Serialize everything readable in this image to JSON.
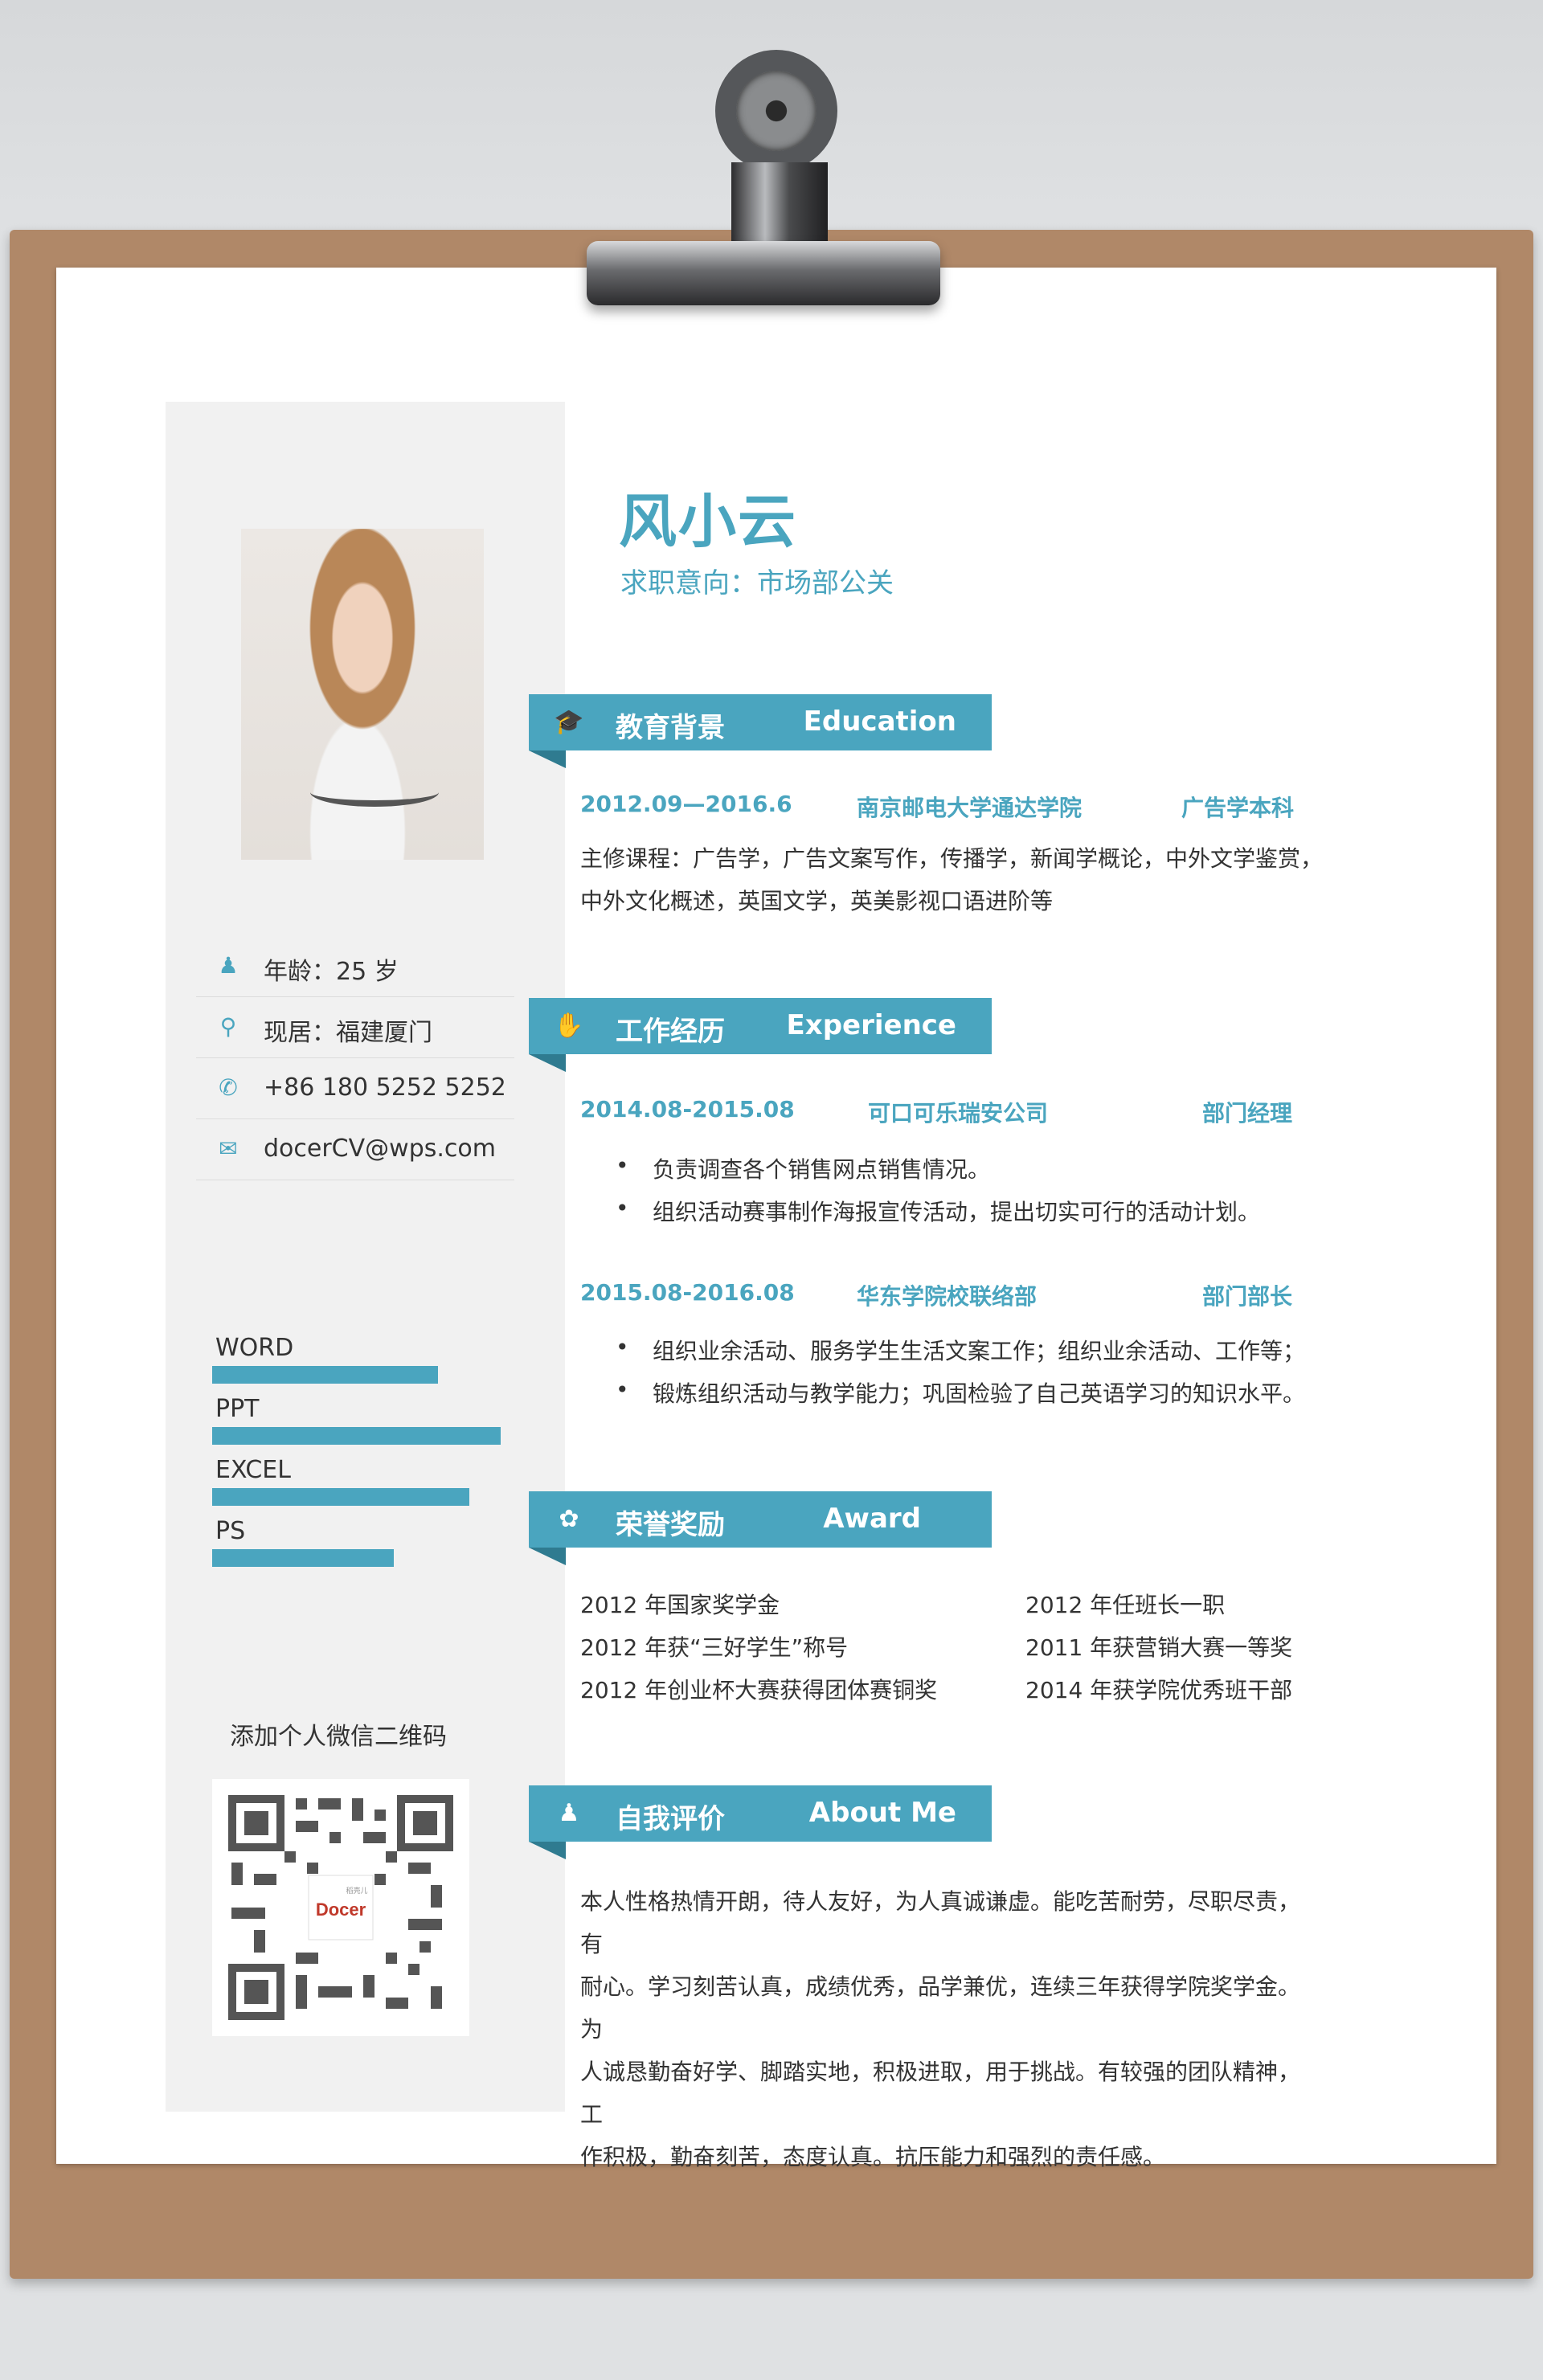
{
  "colors": {
    "accent": "#4aa5bf",
    "board": "#b08868",
    "sidebar": "#f1f1f1"
  },
  "resume": {
    "name": "风小云",
    "intent": "求职意向：市场部公关"
  },
  "personal": [
    {
      "icon": "person-icon",
      "text": "年龄：25 岁"
    },
    {
      "icon": "location-pin-icon",
      "text": "现居：福建厦门"
    },
    {
      "icon": "phone-icon",
      "text": "+86 180 5252 5252"
    },
    {
      "icon": "email-icon",
      "text": "docerCV@wps.com"
    }
  ],
  "skills": [
    {
      "name": "WORD",
      "level": 0.72
    },
    {
      "name": "PPT",
      "level": 0.92
    },
    {
      "name": "EXCEL",
      "level": 0.82
    },
    {
      "name": "PS",
      "level": 0.58
    }
  ],
  "qr": {
    "label": "添加个人微信二维码",
    "logo_text": "Docer",
    "logo_small": "稻壳儿"
  },
  "education": {
    "title_cn": "教育背景",
    "title_en": "Education",
    "icon": "graduation-cap-icon",
    "period": "2012.09—2016.6",
    "school": "南京邮电大学通达学院",
    "degree": "广告学本科",
    "lines": [
      "主修课程：广告学，广告文案写作，传播学，新闻学概论，中外文学鉴赏，",
      "中外文化概述，英国文学，英美影视口语进阶等"
    ]
  },
  "experience": {
    "title_cn": "工作经历",
    "title_en": "Experience",
    "icon": "hand-icon",
    "jobs": [
      {
        "period": "2014.08-2015.08",
        "company": "可口可乐瑞安公司",
        "role": "部门经理",
        "bullets": [
          "负责调查各个销售网点销售情况。",
          "组织活动赛事制作海报宣传活动，提出切实可行的活动计划。"
        ]
      },
      {
        "period": "2015.08-2016.08",
        "company": "华东学院校联络部",
        "role": "部门部长",
        "bullets": [
          "组织业余活动、服务学生生活文案工作；组织业余活动、工作等；",
          "锻炼组织活动与教学能力；巩固检验了自己英语学习的知识水平。"
        ]
      }
    ],
    "bullet_char": "•"
  },
  "awards": {
    "title_cn": "荣誉奖励",
    "title_en": "Award",
    "icon": "leaf-icon",
    "left": [
      "2012 年国家奖学金",
      "2012 年获“三好学生”称号",
      "2012 年创业杯大赛获得团体赛铜奖"
    ],
    "right": [
      "2012 年任班长一职",
      "2011 年获营销大赛一等奖",
      "2014 年获学院优秀班干部"
    ]
  },
  "about": {
    "title_cn": "自我评价",
    "title_en": "About Me",
    "icon": "person-icon",
    "lines": [
      "本人性格热情开朗，待人友好，为人真诚谦虚。能吃苦耐劳，尽职尽责，有",
      "耐心。学习刻苦认真，成绩优秀，品学兼优，连续三年获得学院奖学金。为",
      "人诚恳勤奋好学、脚踏实地，积极进取，用于挑战。有较强的团队精神，工",
      "作积极，勤奋刻苦，态度认真。抗压能力和强烈的责任感。"
    ]
  }
}
